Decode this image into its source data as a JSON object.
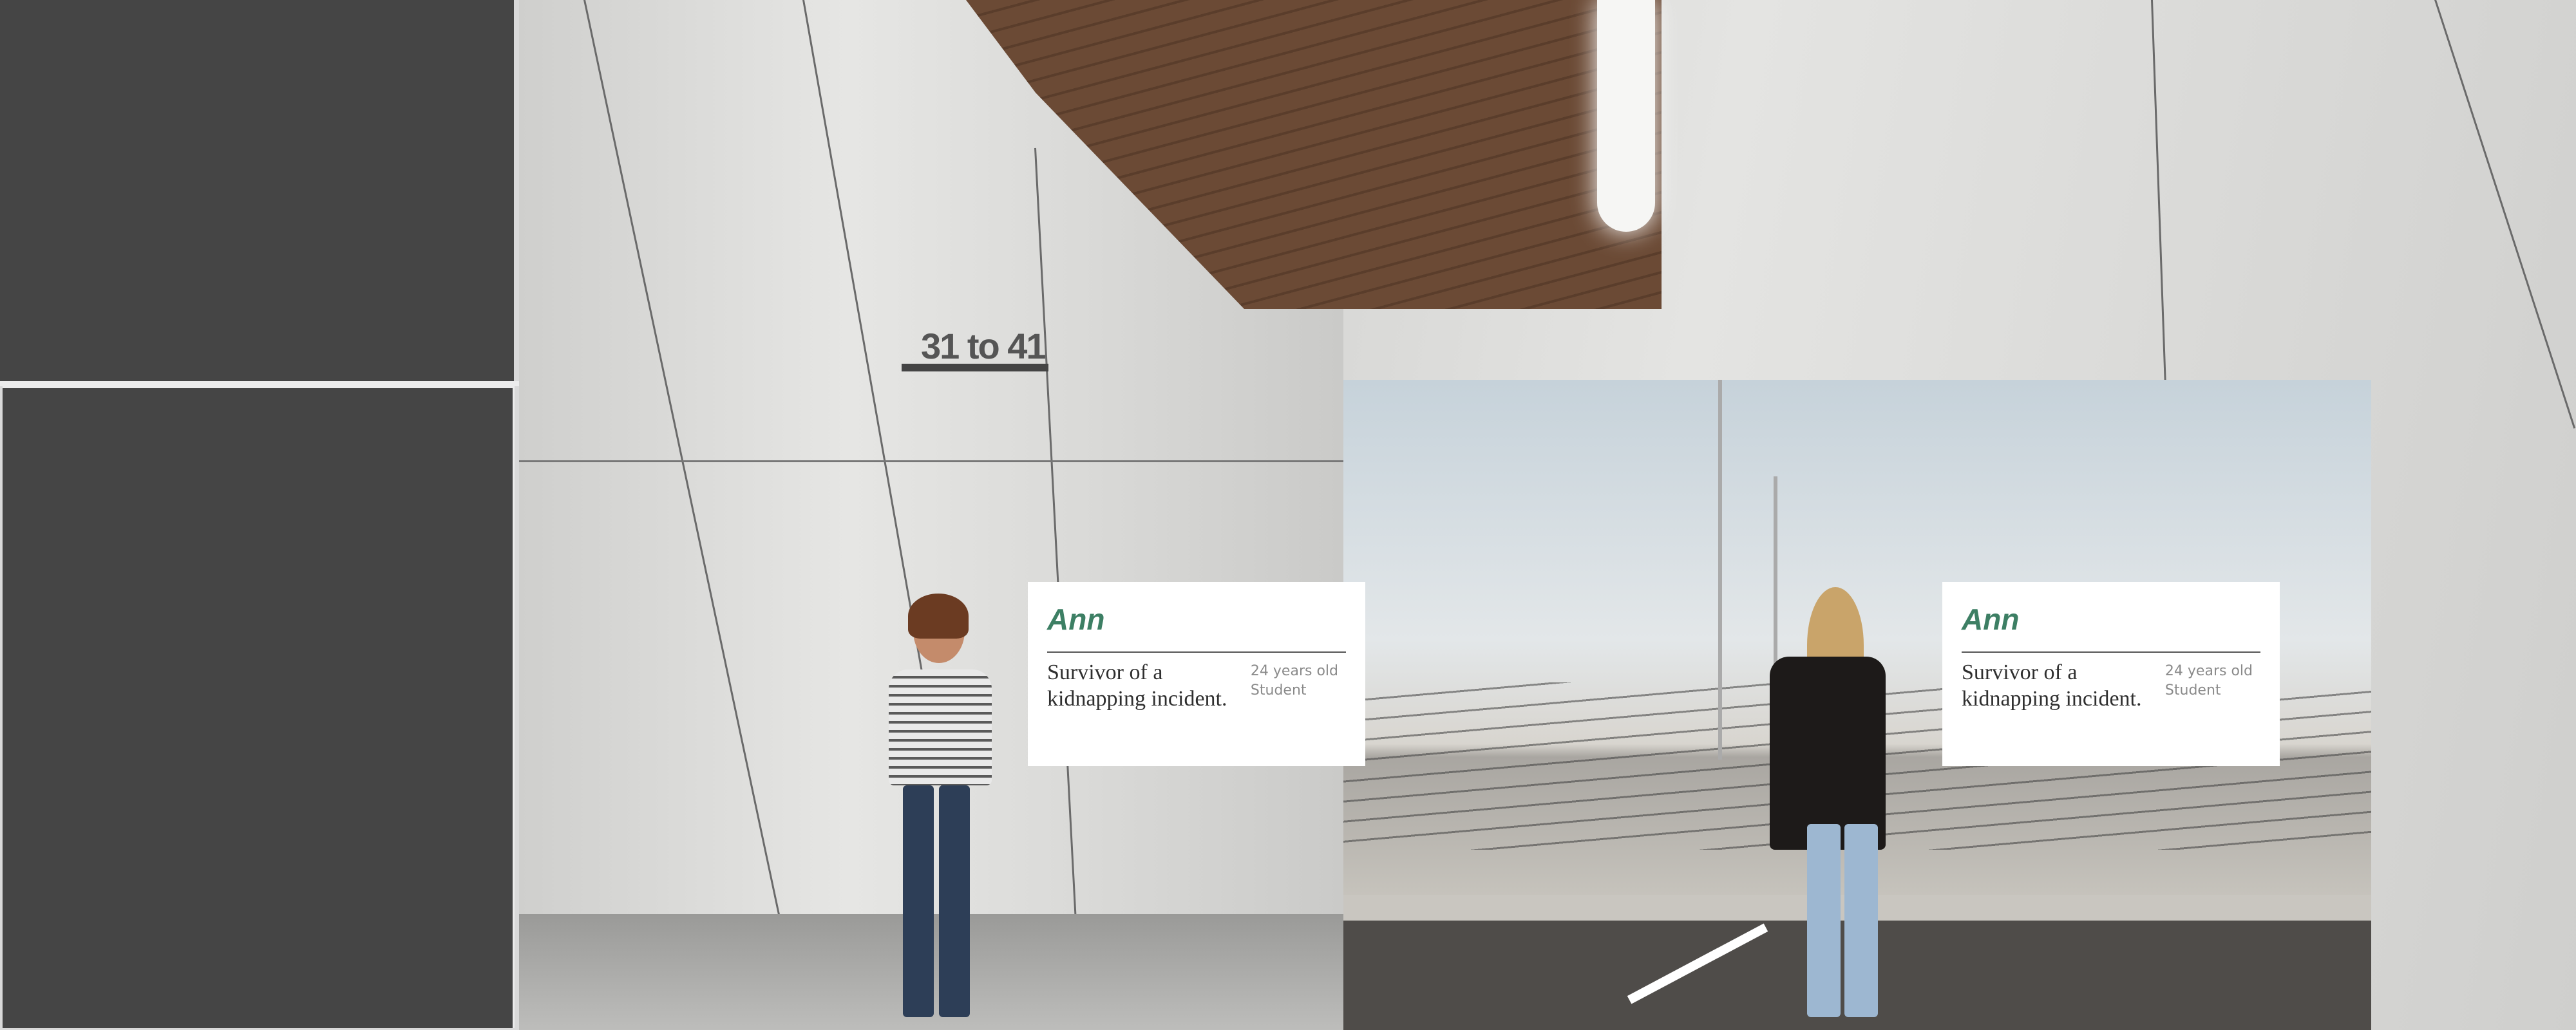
{
  "sign": {
    "text": "31 to 41"
  },
  "cards": [
    {
      "name": "Ann",
      "description": "Survivor of a kidnapping incident.",
      "age": "24 years old",
      "occupation": "Student"
    },
    {
      "name": "Ann",
      "description": "Survivor of a kidnapping incident.",
      "age": "24 years old",
      "occupation": "Student"
    }
  ],
  "colors": {
    "panel": "#454545",
    "accent_name": "#3d7f64",
    "card_bg": "#ffffff"
  }
}
